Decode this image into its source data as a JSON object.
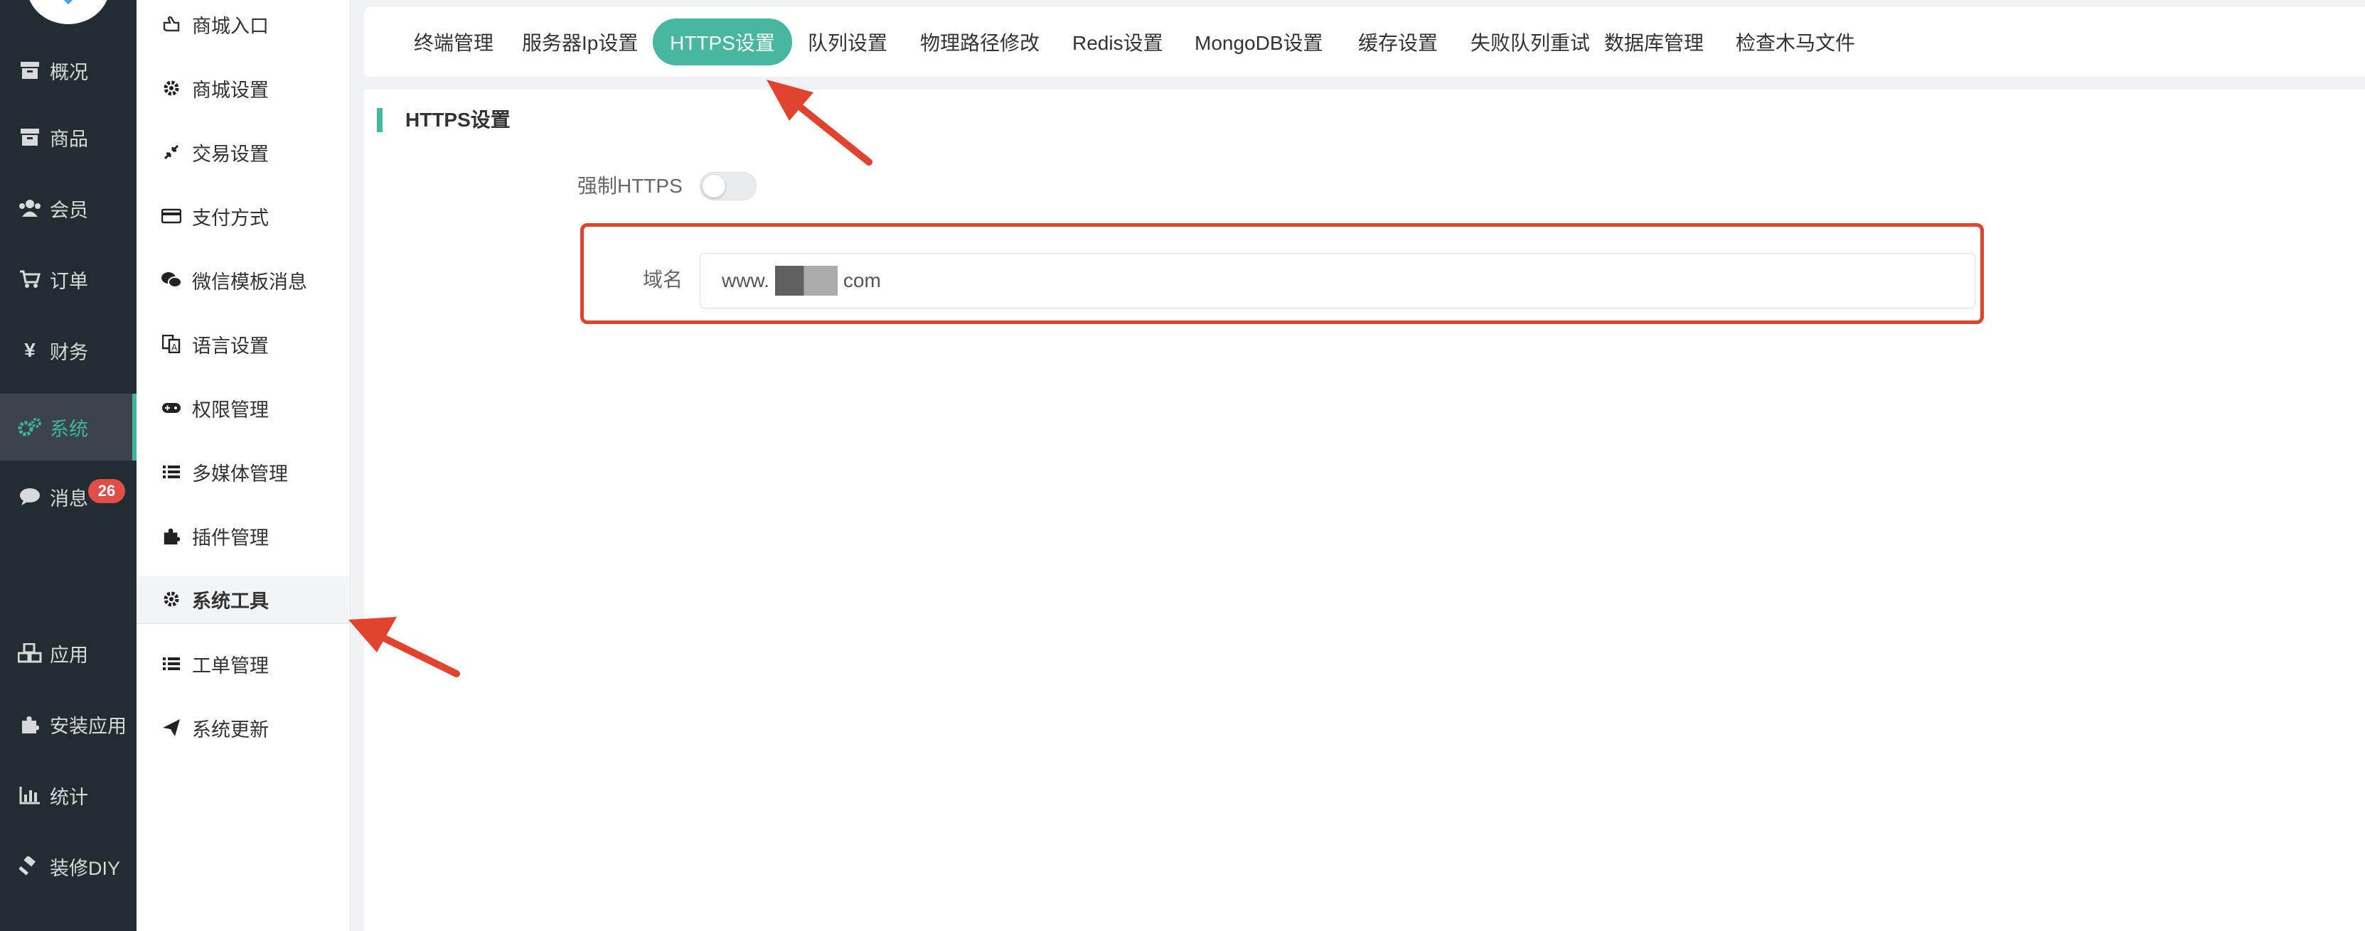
{
  "nav": {
    "items": [
      {
        "label": "概况",
        "icon": "archive-icon"
      },
      {
        "label": "商品",
        "icon": "archive-icon"
      },
      {
        "label": "会员",
        "icon": "users-icon"
      },
      {
        "label": "订单",
        "icon": "cart-icon"
      },
      {
        "label": "财务",
        "icon": "yen-icon"
      },
      {
        "label": "系统",
        "icon": "gears-icon",
        "active": true
      },
      {
        "label": "消息",
        "icon": "comment-icon",
        "badge": "26"
      },
      {
        "label": "应用",
        "icon": "cubes-icon"
      },
      {
        "label": "安装应用",
        "icon": "puzzle-icon"
      },
      {
        "label": "统计",
        "icon": "bar-chart-icon"
      },
      {
        "label": "装修DIY",
        "icon": "gavel-icon"
      }
    ]
  },
  "submenu": {
    "items": [
      {
        "label": "商城入口",
        "icon": "hand-point-icon"
      },
      {
        "label": "商城设置",
        "icon": "gear-icon"
      },
      {
        "label": "交易设置",
        "icon": "compress-icon"
      },
      {
        "label": "支付方式",
        "icon": "credit-card-icon"
      },
      {
        "label": "微信模板消息",
        "icon": "wechat-icon"
      },
      {
        "label": "语言设置",
        "icon": "language-icon"
      },
      {
        "label": "权限管理",
        "icon": "gamepad-icon"
      },
      {
        "label": "多媒体管理",
        "icon": "list-icon"
      },
      {
        "label": "插件管理",
        "icon": "puzzle-icon"
      },
      {
        "label": "系统工具",
        "icon": "gear-icon",
        "active": true
      },
      {
        "label": "工单管理",
        "icon": "list-icon"
      },
      {
        "label": "系统更新",
        "icon": "paper-plane-icon"
      }
    ]
  },
  "tabs": [
    {
      "label": "终端管理"
    },
    {
      "label": "服务器Ip设置"
    },
    {
      "label": "HTTPS设置",
      "active": true
    },
    {
      "label": "队列设置"
    },
    {
      "label": "物理路径修改"
    },
    {
      "label": "Redis设置"
    },
    {
      "label": "MongoDB设置"
    },
    {
      "label": "缓存设置"
    },
    {
      "label": "失败队列重试"
    },
    {
      "label": "数据库管理"
    },
    {
      "label": "检查木马文件"
    }
  ],
  "form": {
    "section_title": "HTTPS设置",
    "force_https_label": "强制HTTPS",
    "force_https_on": false,
    "domain_label": "域名",
    "domain_prefix": "www.",
    "domain_suffix": "com"
  },
  "colors": {
    "accent": "#49b69f",
    "nav_bg": "#222d32",
    "annotation": "#e0432e",
    "badge": "#e04e4a"
  }
}
